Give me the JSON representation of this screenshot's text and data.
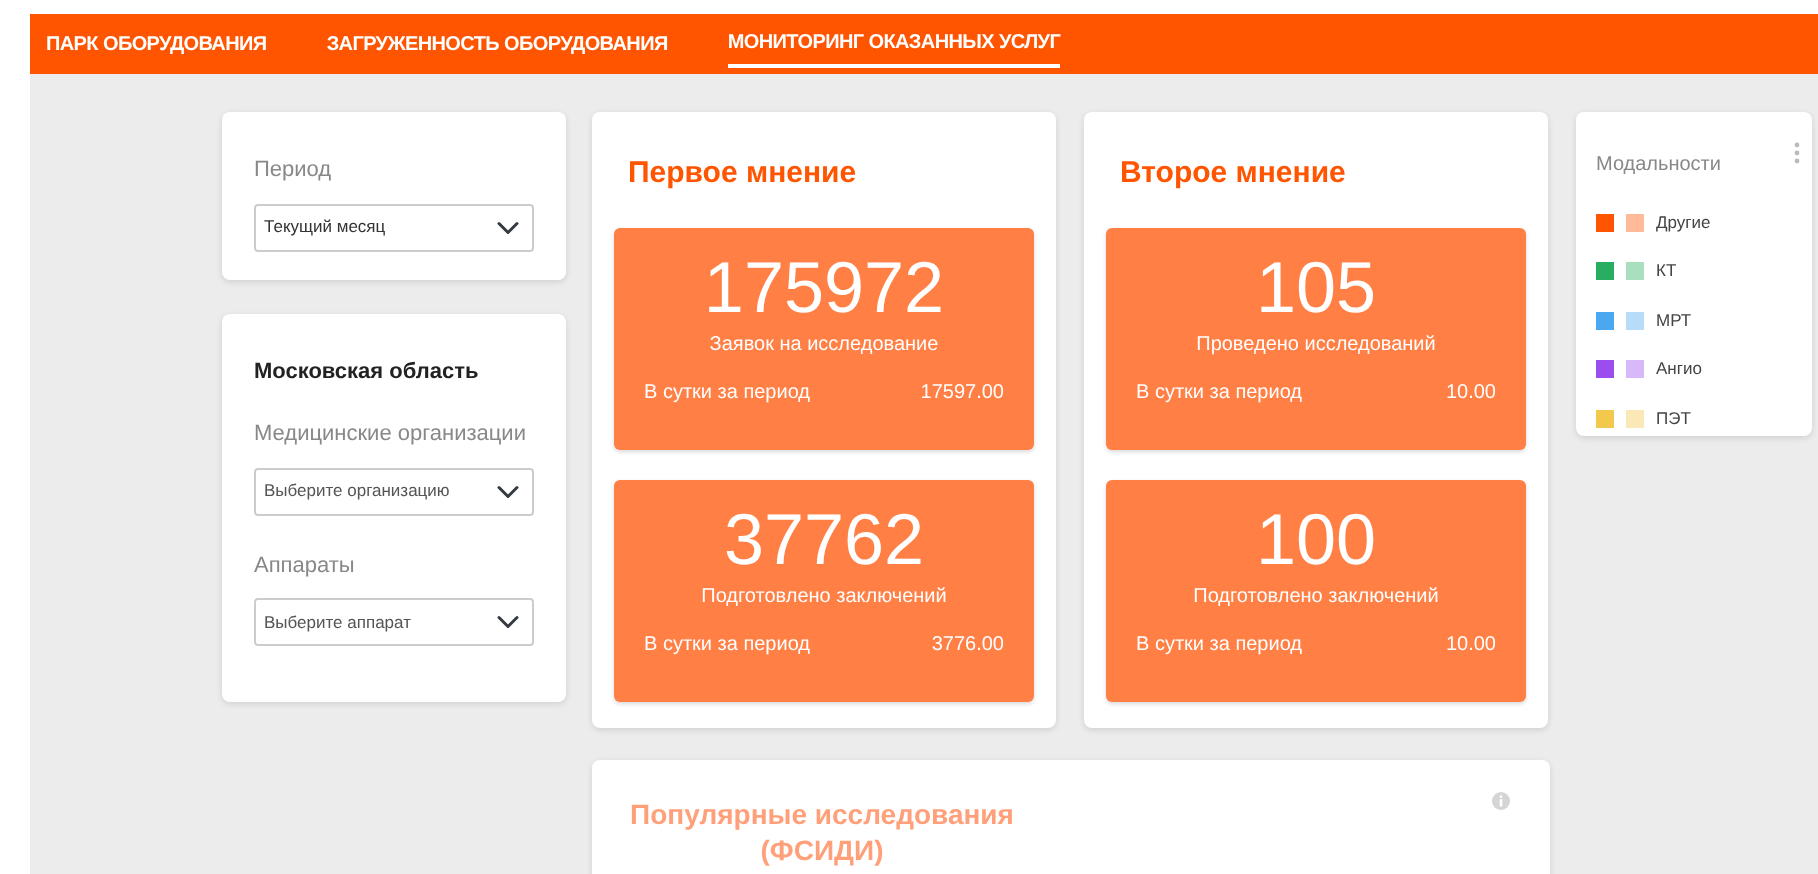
{
  "nav": [
    {
      "label": "ПАРК ОБОРУДОВАНИЯ",
      "selected": false
    },
    {
      "label": "ЗАГРУЖЕННОСТЬ ОБОРУДОВАНИЯ",
      "selected": false
    },
    {
      "label": "МОНИТОРИНГ ОКАЗАННЫХ УСЛУГ",
      "selected": true
    }
  ],
  "filters": {
    "period": {
      "label": "Период",
      "value": "Текущий месяц"
    },
    "region": {
      "title": "Московская область",
      "fields": [
        {
          "label": "Медицинские организации",
          "placeholder": "Выберите организацию"
        },
        {
          "label": "Аппараты",
          "placeholder": "Выберите аппарат"
        }
      ]
    }
  },
  "panels": [
    {
      "title": "Первое мнение",
      "tiles": [
        {
          "value": "175972",
          "caption": "Заявок на исследование",
          "per_label": "В сутки за период",
          "per_value": "17597.00"
        },
        {
          "value": "37762",
          "caption": "Подготовлено заключений",
          "per_label": "В сутки за период",
          "per_value": "3776.00"
        }
      ]
    },
    {
      "title": "Второе мнение",
      "tiles": [
        {
          "value": "105",
          "caption": "Проведено исследований",
          "per_label": "В сутки за период",
          "per_value": "10.00"
        },
        {
          "value": "100",
          "caption": "Подготовлено заключений",
          "per_label": "В сутки за период",
          "per_value": "10.00"
        }
      ]
    }
  ],
  "popular": {
    "title": "Популярные исследования (ФСИДИ)"
  },
  "modalities": {
    "title": "Модальности",
    "items": [
      {
        "label": "Другие",
        "color": "#ff5500"
      },
      {
        "label": "КТ",
        "color": "#27ae60"
      },
      {
        "label": "МРТ",
        "color": "#4aa8f0"
      },
      {
        "label": "Ангио",
        "color": "#9b4df0"
      },
      {
        "label": "ПЭТ",
        "color": "#f2c94c"
      }
    ]
  }
}
